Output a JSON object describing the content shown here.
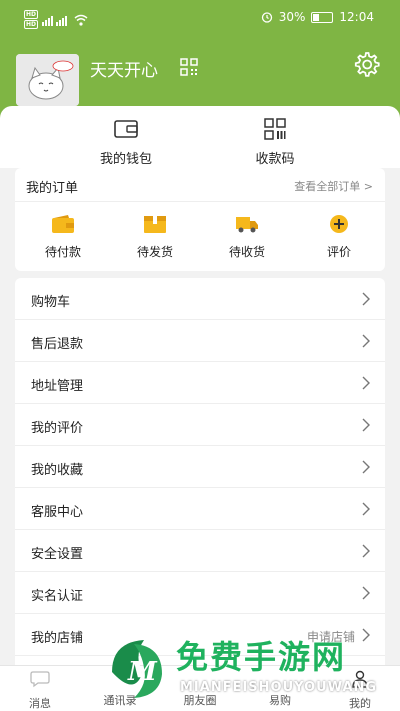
{
  "status": {
    "network_left": "HD HD",
    "battery_pct": "30%",
    "time": "12:04"
  },
  "profile": {
    "username": "天天开心"
  },
  "wallet": {
    "wallet_label": "我的钱包",
    "code_label": "收款码"
  },
  "orders": {
    "title": "我的订单",
    "view_all": "查看全部订单 >",
    "items": [
      {
        "label": "待付款",
        "icon": "wallet-pay-icon"
      },
      {
        "label": "待发货",
        "icon": "box-icon"
      },
      {
        "label": "待收货",
        "icon": "truck-icon"
      },
      {
        "label": "评价",
        "icon": "plus-icon"
      }
    ]
  },
  "menu": {
    "items": [
      {
        "label": "购物车"
      },
      {
        "label": "售后退款"
      },
      {
        "label": "地址管理"
      },
      {
        "label": "我的评价"
      },
      {
        "label": "我的收藏"
      },
      {
        "label": "客服中心"
      },
      {
        "label": "安全设置"
      },
      {
        "label": "实名认证"
      },
      {
        "label": "我的店铺",
        "extra": "申请店铺"
      }
    ]
  },
  "tabs": [
    {
      "label": "消息"
    },
    {
      "label": "通讯录"
    },
    {
      "label": "朋友圈"
    },
    {
      "label": "易购"
    },
    {
      "label": "我的"
    }
  ],
  "watermark": {
    "cn": "免费手游网",
    "en": "MIANFEISHOUYOUWANG"
  },
  "colors": {
    "header_green": "#7fb544",
    "order_icon_yellow": "#f5b81c",
    "watermark_green": "#1fb25e"
  }
}
